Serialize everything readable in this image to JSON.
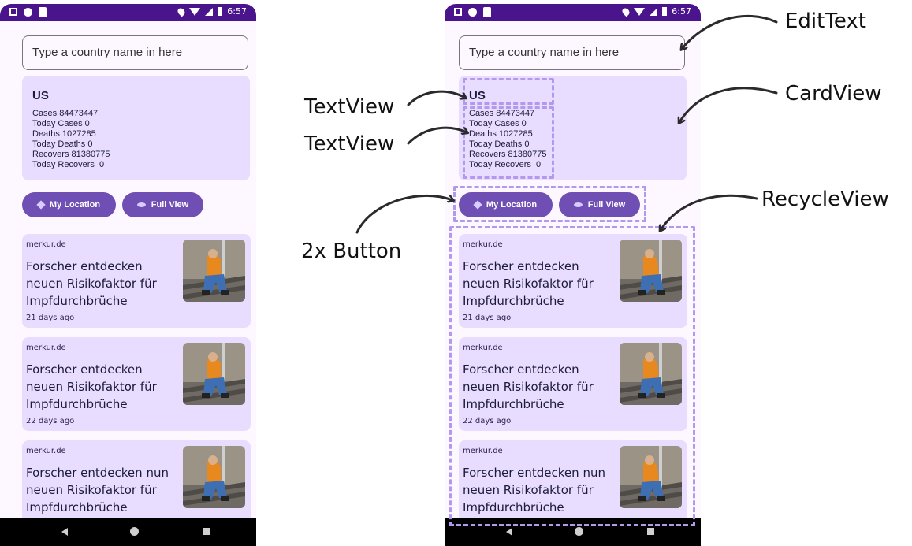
{
  "status_bar": {
    "time": "6:57"
  },
  "search": {
    "placeholder": "Type a country name in here"
  },
  "summary": {
    "country": "US",
    "lines": [
      "Cases 84473447",
      "Today Cases 0",
      "Deaths 1027285",
      "Today Deaths 0",
      "Recovers 81380775",
      "Today Recovers  0"
    ]
  },
  "buttons": {
    "my_location": "My Location",
    "full_view": "Full View"
  },
  "news": [
    {
      "source": "merkur.de",
      "title": "Forscher entdecken neuen Risikofaktor für Impfdurchbrüche",
      "ago": "21 days ago"
    },
    {
      "source": "merkur.de",
      "title": "Forscher entdecken neuen Risikofaktor für Impfdurchbrüche",
      "ago": "22 days ago"
    },
    {
      "source": "merkur.de",
      "title": "Forscher entdecken nun neuen Risikofaktor für Impfdurchbrüche",
      "ago": ""
    }
  ],
  "annotations": {
    "edittext": "EditText",
    "cardview": "CardView",
    "textview_1": "TextView",
    "textview_2": "TextView",
    "recycleview": "RecycleView",
    "buttons": "2x Button"
  },
  "colors": {
    "status_bar": "#4a148c",
    "card": "#e9ddff",
    "button": "#6f4fb3",
    "dash": "#b399ee"
  }
}
